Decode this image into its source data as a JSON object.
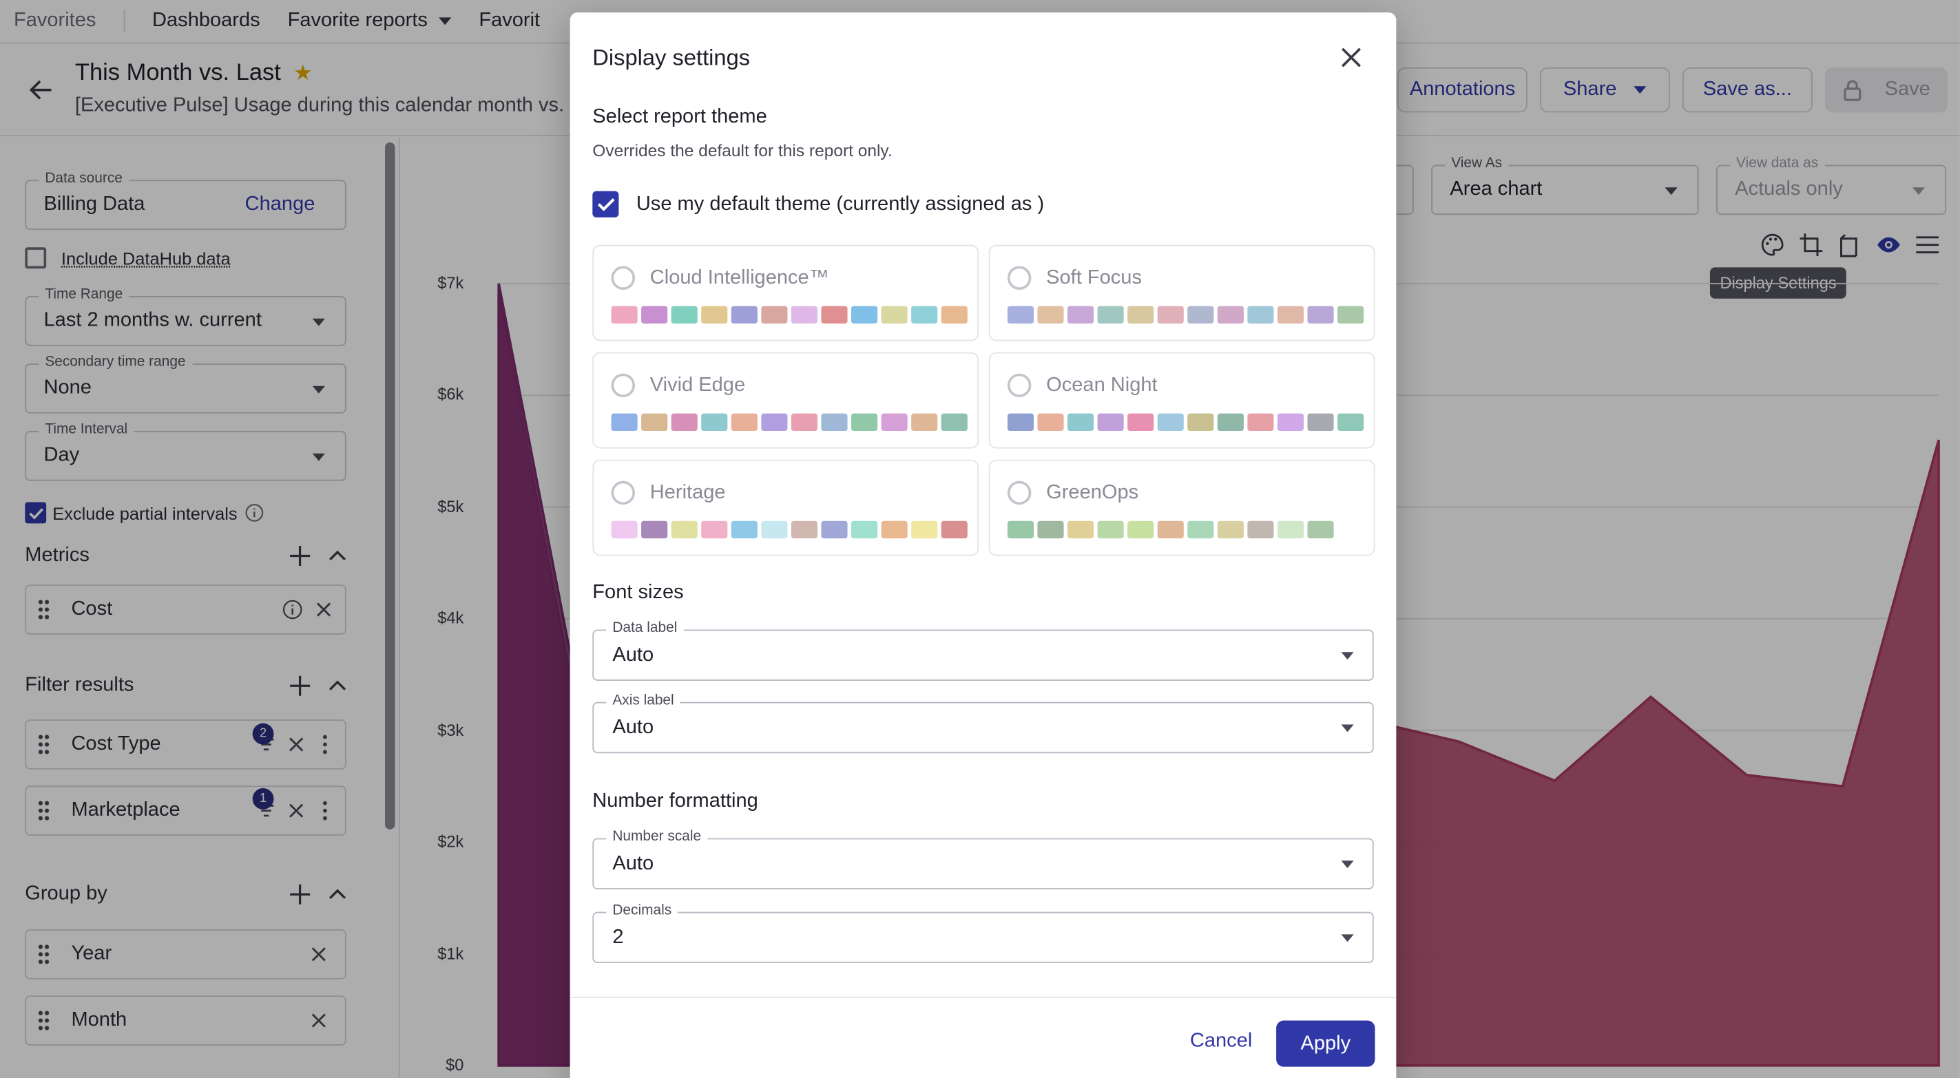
{
  "topnav": {
    "items": [
      "Favorites",
      "Dashboards",
      "Favorite reports",
      "Favorit"
    ]
  },
  "header": {
    "title": "This Month vs. Last",
    "subtitle": "[Executive Pulse] Usage during this calendar month vs.",
    "buttons": {
      "annotations": "Annotations",
      "share": "Share",
      "save_as": "Save as...",
      "save": "Save"
    }
  },
  "sidebar": {
    "data_source": {
      "label": "Data source",
      "value": "Billing Data",
      "action": "Change"
    },
    "include_datahub": "Include DataHub data",
    "time_range": {
      "label": "Time Range",
      "value": "Last 2 months w. current"
    },
    "secondary_time_range": {
      "label": "Secondary time range",
      "value": "None"
    },
    "time_interval": {
      "label": "Time Interval",
      "value": "Day"
    },
    "exclude_partial": "Exclude partial intervals",
    "metrics": {
      "title": "Metrics",
      "items": [
        "Cost"
      ]
    },
    "filters": {
      "title": "Filter results",
      "items": [
        {
          "label": "Cost Type",
          "count": "2"
        },
        {
          "label": "Marketplace",
          "count": "1"
        }
      ]
    },
    "group_by": {
      "title": "Group by",
      "items": [
        "Year",
        "Month"
      ]
    }
  },
  "main": {
    "view_as": {
      "label": "View As",
      "value": "Area chart"
    },
    "view_data_as": {
      "label": "View data as",
      "value": "Actuals only"
    },
    "tooltip": "Display Settings"
  },
  "chart_data": {
    "type": "area",
    "y_ticks": [
      "$7k",
      "$6k",
      "$5k",
      "$4k",
      "$3k",
      "$2k",
      "$1k",
      "$0"
    ],
    "ylim": [
      0,
      7000
    ],
    "series": [
      {
        "name": "",
        "color": "#7b2d6e",
        "x": [
          0,
          1,
          2
        ],
        "values": [
          7000,
          2550,
          2600
        ]
      },
      {
        "name": "",
        "color": "#a83a5f",
        "x": [
          0,
          1,
          2,
          3,
          4,
          5,
          6,
          7,
          8,
          9,
          10,
          11,
          12,
          13,
          14,
          15
        ],
        "values": [
          6900,
          2300,
          2500,
          2600,
          2550,
          2500,
          2300,
          2300,
          2550,
          3100,
          2900,
          2550,
          3300,
          2600,
          2500,
          5600
        ]
      }
    ]
  },
  "modal": {
    "title": "Display settings",
    "theme_heading": "Select report theme",
    "theme_note": "Overrides the default for this report only.",
    "use_default": "Use my default theme (currently assigned as )",
    "themes": [
      {
        "name": "Cloud Intelligence™",
        "colors": [
          "#f0a8c0",
          "#c890d0",
          "#80d0c0",
          "#e0c890",
          "#a0a0d8",
          "#d8a8a0",
          "#e0b8e8",
          "#e09090",
          "#80c0e8",
          "#d8d8a0",
          "#90d0d8",
          "#e8b890"
        ]
      },
      {
        "name": "Soft Focus",
        "colors": [
          "#a8b0e0",
          "#e0c0a0",
          "#c8a8d8",
          "#a0c8c0",
          "#d8c8a0",
          "#e0b0b8",
          "#b0b8d0",
          "#d0a8c8",
          "#a0c8d8",
          "#e0b8a8",
          "#b8a8d8",
          "#a8c8a8"
        ]
      },
      {
        "name": "Vivid Edge",
        "colors": [
          "#90b0e8",
          "#d8b890",
          "#d890b8",
          "#90c8d0",
          "#e8b098",
          "#b0a0e0",
          "#e8a0b0",
          "#a0b8d8",
          "#90c8a8",
          "#d8a0d8",
          "#e0b898",
          "#90c0b0"
        ]
      },
      {
        "name": "Ocean Night",
        "colors": [
          "#90a0d0",
          "#e8b098",
          "#90c8d0",
          "#c0a0d8",
          "#e890b0",
          "#a0c8e0",
          "#c8c090",
          "#90b8a8",
          "#e8a0a8",
          "#d0a8e8",
          "#a8a8b0",
          "#90c8b8"
        ]
      },
      {
        "name": "Heritage",
        "colors": [
          "#f0c8f0",
          "#a888b8",
          "#e0e0a0",
          "#f0b0c8",
          "#90c8e8",
          "#c8e8f0",
          "#d0b8b0",
          "#a0a8d8",
          "#a0e0d0",
          "#e8b890",
          "#f0e8a0",
          "#d89090"
        ]
      },
      {
        "name": "GreenOps",
        "colors": [
          "#98c8a8",
          "#a0b8a0",
          "#e0d098",
          "#b8d8a8",
          "#c8e0a0",
          "#e0b898",
          "#a8d8b8",
          "#d8d0a0",
          "#c0b8b0",
          "#d0e8c8",
          "#a8c8a8"
        ]
      }
    ],
    "font_heading": "Font sizes",
    "data_label": {
      "label": "Data label",
      "value": "Auto"
    },
    "axis_label": {
      "label": "Axis label",
      "value": "Auto"
    },
    "number_heading": "Number formatting",
    "number_scale": {
      "label": "Number scale",
      "value": "Auto"
    },
    "decimals": {
      "label": "Decimals",
      "value": "2"
    },
    "cancel": "Cancel",
    "apply": "Apply"
  }
}
